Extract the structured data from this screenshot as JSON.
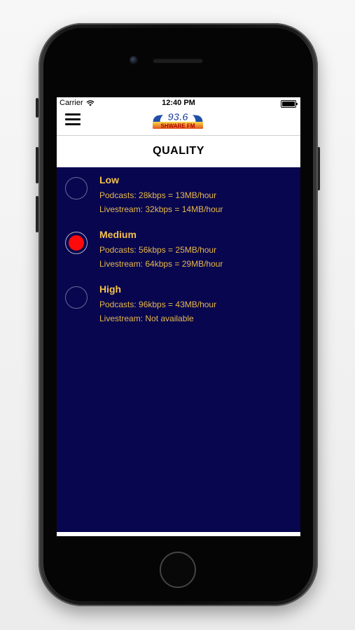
{
  "status_bar": {
    "carrier": "Carrier",
    "time": "12:40 PM"
  },
  "logo": {
    "text_top": "93.6",
    "text_bottom": "SHWARE FM"
  },
  "page": {
    "title": "QUALITY"
  },
  "options": [
    {
      "title": "Low",
      "podcasts": "Podcasts: 28kbps = 13MB/hour",
      "livestream": "Livestream: 32kbps = 14MB/hour",
      "selected": false
    },
    {
      "title": "Medium",
      "podcasts": "Podcasts: 56kbps = 25MB/hour",
      "livestream": "Livestream: 64kbps = 29MB/hour",
      "selected": true
    },
    {
      "title": "High",
      "podcasts": "Podcasts: 96kbps = 43MB/hour",
      "livestream": "Livestream: Not available",
      "selected": false
    }
  ],
  "colors": {
    "content_bg": "#07064f",
    "accent_text": "#f5c24a",
    "selected_dot": "#ff0a0a"
  },
  "icons": {
    "menu": "hamburger-menu-icon",
    "wifi": "wifi-icon",
    "battery": "battery-icon"
  }
}
